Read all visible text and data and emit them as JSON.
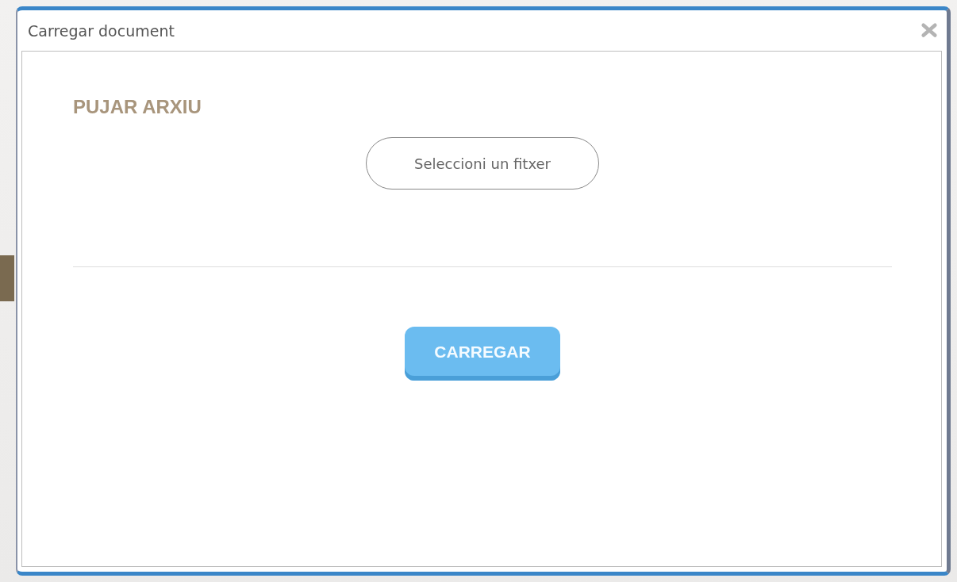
{
  "dialog": {
    "title": "Carregar document",
    "section_title": "PUJAR ARXIU",
    "file_button": "Seleccioni un fitxer",
    "submit_button": "CARREGAR"
  }
}
